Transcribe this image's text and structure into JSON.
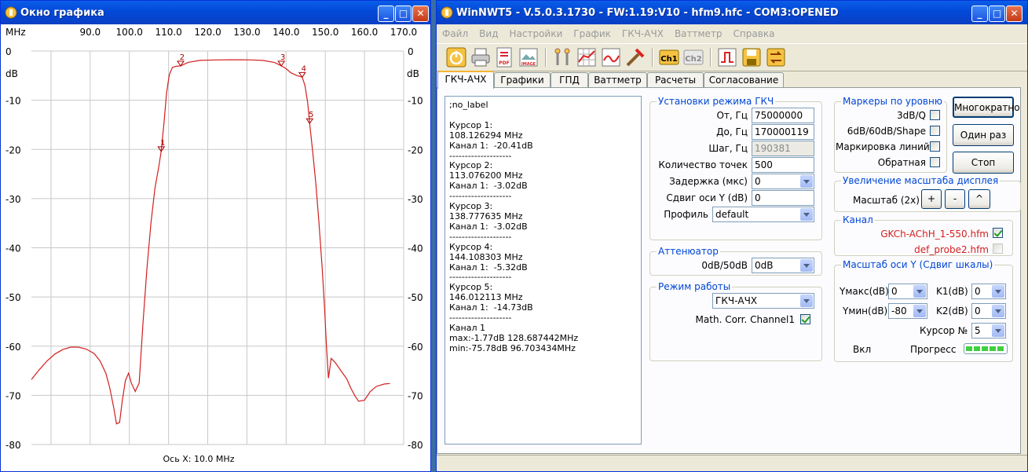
{
  "graph_window": {
    "title": "Окно графика",
    "unit_label": "MHz",
    "db_label_left": "dB",
    "db_label_right": "dB",
    "x_axis_caption": "Ось X: 10.0 MHz"
  },
  "chart_data": {
    "type": "line",
    "x_unit": "MHz",
    "y_unit": "dB",
    "xlim": [
      80,
      170
    ],
    "ylim": [
      -80,
      0
    ],
    "grid": true,
    "x_ticks": [
      "90.0",
      "100.0",
      "110.0",
      "120.0",
      "130.0",
      "140.0",
      "150.0",
      "160.0",
      "170.0"
    ],
    "y_ticks": [
      "0",
      "-10",
      "-20",
      "-30",
      "-40",
      "-50",
      "-60",
      "-70",
      "-80"
    ],
    "series": [
      {
        "color": "#d21f1f",
        "x": [
          75.0,
          77.0,
          79.0,
          81.0,
          83.0,
          85.0,
          87.0,
          89.0,
          91.0,
          92.5,
          94.0,
          95.0,
          96.0,
          96.7,
          97.5,
          98.2,
          99.0,
          99.8,
          100.5,
          101.5,
          102.5,
          103.5,
          104.5,
          105.5,
          106.5,
          107.5,
          108.1,
          108.8,
          109.5,
          110.2,
          111.0,
          112.0,
          113.1,
          115.0,
          118.0,
          122.0,
          126.0,
          128.7,
          131.0,
          134.0,
          137.0,
          138.8,
          140.0,
          141.2,
          142.5,
          144.1,
          144.8,
          145.5,
          146.0,
          146.8,
          147.6,
          148.4,
          149.2,
          149.8,
          150.3,
          150.8,
          151.5,
          152.5,
          154.0,
          155.5,
          156.5,
          157.5,
          158.5,
          160.0,
          161.5,
          163.0,
          165.0,
          166.5
        ],
        "y": [
          -66.8,
          -64.8,
          -63.0,
          -61.6,
          -60.7,
          -60.2,
          -60.2,
          -60.6,
          -61.5,
          -63.0,
          -65.5,
          -68.5,
          -72.5,
          -75.8,
          -75.5,
          -71.0,
          -67.0,
          -65.5,
          -67.5,
          -69.2,
          -67.5,
          -55.0,
          -44.0,
          -35.0,
          -28.0,
          -23.5,
          -20.4,
          -15.0,
          -8.5,
          -4.8,
          -3.3,
          -3.1,
          -3.0,
          -2.3,
          -1.9,
          -1.8,
          -1.77,
          -1.77,
          -1.8,
          -1.9,
          -2.3,
          -3.0,
          -3.6,
          -4.4,
          -4.9,
          -5.3,
          -7.0,
          -10.5,
          -14.7,
          -20.5,
          -27.0,
          -35.0,
          -44.0,
          -52.0,
          -60.0,
          -66.5,
          -62.5,
          -63.3,
          -65.0,
          -66.7,
          -68.5,
          -70.0,
          -71.2,
          -71.0,
          -69.2,
          -68.2,
          -67.7,
          -67.6
        ]
      }
    ],
    "markers": [
      {
        "label": "1",
        "x": 108.126294,
        "y": -20.41
      },
      {
        "label": "2",
        "x": 113.0762,
        "y": -3.02
      },
      {
        "label": "3",
        "x": 138.777635,
        "y": -3.02
      },
      {
        "label": "4",
        "x": 144.108303,
        "y": -5.32
      },
      {
        "label": "5",
        "x": 146.012113,
        "y": -14.73
      }
    ]
  },
  "main_window": {
    "title": "WinNWT5 - V.5.0.3.1730 - FW:1.19:V10 - hfm9.hfc - COM3:OPENED",
    "menu": [
      "Файл",
      "Вид",
      "Настройки",
      "График",
      "ГКЧ-АЧХ",
      "Ваттметр",
      "Справка"
    ],
    "toolbar_labels": {
      "pdf": "PDF",
      "image": "IMAGE",
      "ch1": "Ch1",
      "ch2": "Ch2"
    },
    "tabs": [
      "ГКЧ-АЧХ",
      "Графики",
      "ГПД",
      "Ваттметр",
      "Расчеты",
      "Согласование"
    ],
    "memo": ";no_label\n\nКурсор 1:\n108.126294 MHz\nКанал 1:  -20.41dB\n--------------------\nКурсор 2:\n113.076200 MHz\nКанал 1:  -3.02dB\n--------------------\nКурсор 3:\n138.777635 MHz\nКанал 1:  -3.02dB\n--------------------\nКурсор 4:\n144.108303 MHz\nКанал 1:  -5.32dB\n--------------------\nКурсор 5:\n146.012113 MHz\nКанал 1:  -14.73dB\n--------------------\nКанал 1\nmax:-1.77dB 128.687442MHz\nmin:-75.78dB 96.703434MHz",
    "gkch": {
      "title": "Установки режима ГКЧ",
      "from_label": "От, Гц",
      "from_value": "75000000",
      "to_label": "До, Гц",
      "to_value": "170000119",
      "step_label": "Шаг, Гц",
      "step_value": "190381",
      "points_label": "Количество точек",
      "points_value": "500",
      "delay_label": "Задержка (мкс)",
      "delay_value": "0",
      "yshift_label": "Сдвиг оси Y (dB)",
      "yshift_value": "0",
      "profile_label": "Профиль",
      "profile_value": "default"
    },
    "attenuator": {
      "title": "Аттенюатор",
      "label": "0dB/50dB",
      "value": "0dB"
    },
    "mode": {
      "title": "Режим работы",
      "value": "ГКЧ-АЧХ",
      "math_label": "Math. Corr. Channel1",
      "math_checked": true
    },
    "markers": {
      "title": "Маркеры по уровню",
      "items": [
        {
          "label": "3dB/Q",
          "checked": false
        },
        {
          "label": "6dB/60dB/Shape",
          "checked": false
        },
        {
          "label": "Маркировка линий",
          "checked": false
        },
        {
          "label": "Обратная",
          "checked": false
        }
      ]
    },
    "buttons": {
      "multi": "Многократно",
      "once": "Один раз",
      "stop": "Стоп"
    },
    "zoom": {
      "title": "Увеличение масштаба дисплея",
      "label": "Масштаб (2x)",
      "plus": "+",
      "minus": "-",
      "caret": "^"
    },
    "channel": {
      "title": "Канал",
      "ch1_file": "GKCh-AChH_1-550.hfm",
      "ch1_checked": true,
      "ch2_file": "def_probe2.hfm",
      "ch2_checked": false,
      "file_color": "#d22020"
    },
    "yscale": {
      "title": "Масштаб оси Y (Сдвиг шкалы)",
      "ymax_label": "Yмакс(dB)",
      "ymax_value": "0",
      "k1_label": "K1(dB)",
      "k1_value": "0",
      "ymin_label": "Yмин(dB)",
      "ymin_value": "-80",
      "k2_label": "K2(dB)",
      "k2_value": "0",
      "cursor_label": "Курсор №",
      "cursor_value": "5",
      "on_label": "Вкл",
      "progress_label": "Прогресс"
    }
  }
}
